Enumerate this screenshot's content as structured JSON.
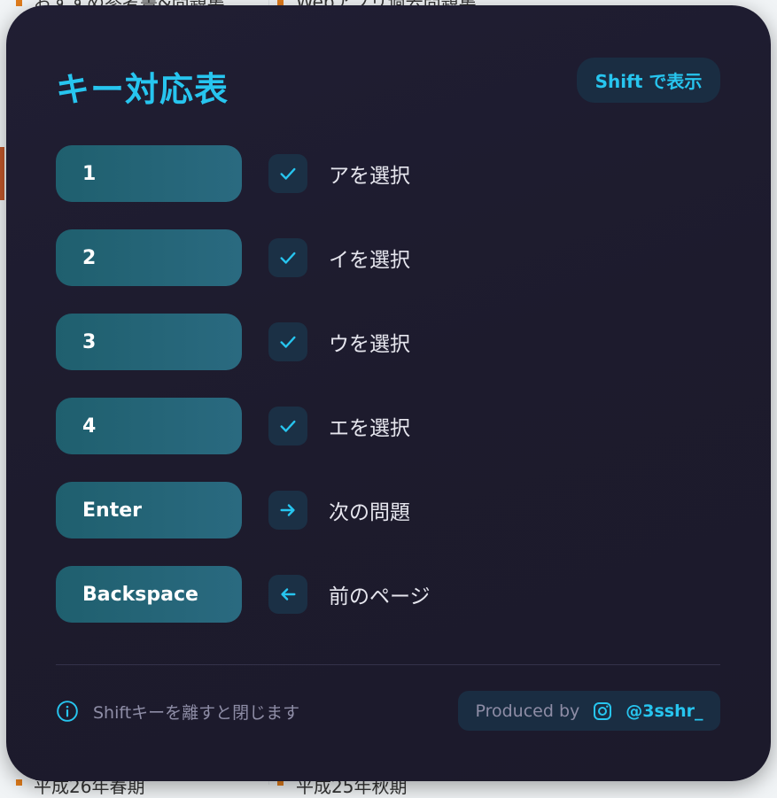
{
  "background": {
    "top_left_text": "おすすめ参考書&問題集",
    "top_right_text": "Webアプリ過去問題集",
    "bottom_left_text": "平成26年春期",
    "bottom_right_text": "平成25年秋期"
  },
  "modal": {
    "title": "キー対応表",
    "shift_button_label": "Shift で表示",
    "rows": [
      {
        "key": "1",
        "icon": "check-icon",
        "action": "アを選択"
      },
      {
        "key": "2",
        "icon": "check-icon",
        "action": "イを選択"
      },
      {
        "key": "3",
        "icon": "check-icon",
        "action": "ウを選択"
      },
      {
        "key": "4",
        "icon": "check-icon",
        "action": "エを選択"
      },
      {
        "key": "Enter",
        "icon": "arrow-right-icon",
        "action": "次の問題"
      },
      {
        "key": "Backspace",
        "icon": "arrow-left-icon",
        "action": "前のページ"
      }
    ],
    "footer": {
      "note": "Shiftキーを離すと閉じます",
      "produced_by": "Produced by",
      "handle": "@3sshr_",
      "info_icon": "info-icon",
      "social_icon": "instagram-icon"
    }
  },
  "colors": {
    "accent": "#27c5ef",
    "modal_bg": "#1e1c2f",
    "key_bg": "#245f72",
    "icon_bg": "#1b3045"
  }
}
